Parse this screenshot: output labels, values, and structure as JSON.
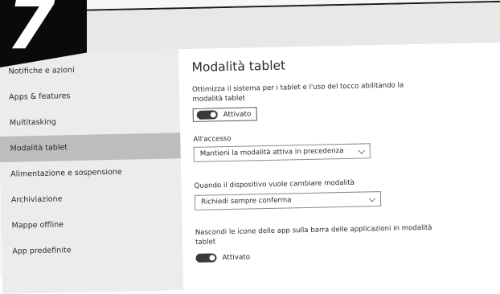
{
  "badge": {
    "number": "7"
  },
  "sidebar": {
    "items": [
      {
        "label": "Notifiche e azioni",
        "selected": false
      },
      {
        "label": "Apps & features",
        "selected": false
      },
      {
        "label": "Multitasking",
        "selected": false
      },
      {
        "label": "Modalità tablet",
        "selected": true
      },
      {
        "label": "Alimentazione e sospensione",
        "selected": false
      },
      {
        "label": "Archiviazione",
        "selected": false
      },
      {
        "label": "Mappe offline",
        "selected": false
      },
      {
        "label": "App predefinite",
        "selected": false
      }
    ]
  },
  "main": {
    "title": "Modalità tablet",
    "tablet_mode": {
      "description": "Ottimizza il sistema per i tablet e l'uso del tocco abilitando la modalità tablet",
      "toggle_label": "Attivato",
      "state": "on"
    },
    "on_login": {
      "label": "All'accesso",
      "selected": "Mantieni la modalità attiva in precedenza"
    },
    "device_switch": {
      "label": "Quando il dispositivo vuole cambiare  modalità",
      "selected": "Richiedi sempre conferma"
    },
    "hide_icons": {
      "description": "Nascondi le icone delle app sulla barra delle applicazioni in modalità tablet",
      "toggle_label": "Attivato",
      "state": "on"
    }
  },
  "colors": {
    "sidebar_bg": "#ececea",
    "selected_bg": "#bdbdbb",
    "toggle_on": "#3a3a3a",
    "badge_bg": "#0a0a0a"
  }
}
